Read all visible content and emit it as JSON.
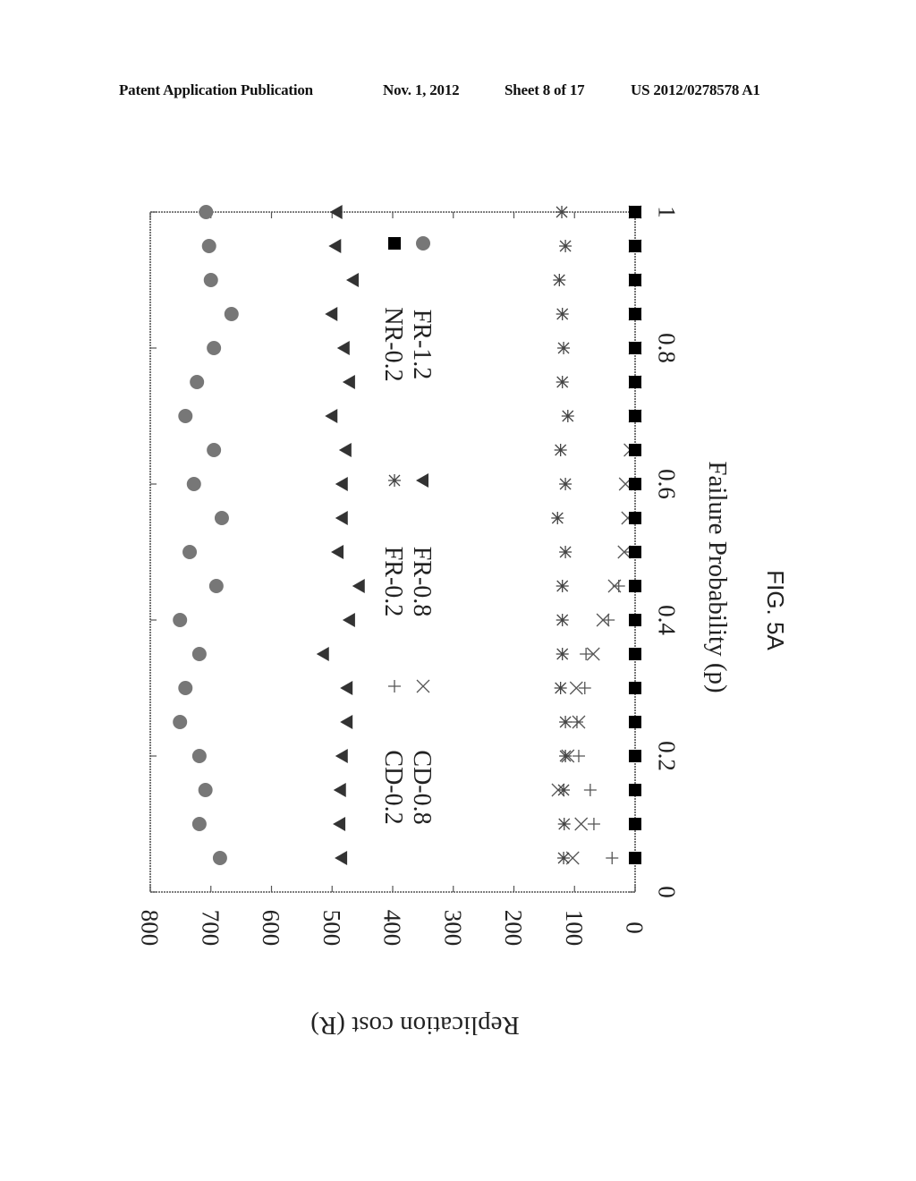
{
  "header": {
    "publication": "Patent Application Publication",
    "date": "Nov. 1, 2012",
    "sheet": "Sheet 8 of 17",
    "number": "US 2012/0278578 A1"
  },
  "figure": {
    "caption": "FIG. 5A",
    "orientation": "rotated 90 degrees clockwise"
  },
  "chart_data": {
    "type": "scatter",
    "title": "",
    "xlabel": "Failure Probability (p)",
    "ylabel": "Replication cost (R)",
    "xlim": [
      0,
      1
    ],
    "ylim": [
      0,
      800
    ],
    "xticks": [
      "0",
      "0.2",
      "0.4",
      "0.6",
      "0.8",
      "1"
    ],
    "xtick_values": [
      0,
      0.2,
      0.4,
      0.6,
      0.8,
      1
    ],
    "yticks": [
      "0",
      "100",
      "200",
      "300",
      "400",
      "500",
      "600",
      "700",
      "800"
    ],
    "ytick_values": [
      0,
      100,
      200,
      300,
      400,
      500,
      600,
      700,
      800
    ],
    "grid": false,
    "legend_placement": "inside, center band",
    "x": [
      0.05,
      0.1,
      0.15,
      0.2,
      0.25,
      0.3,
      0.35,
      0.4,
      0.45,
      0.5,
      0.55,
      0.6,
      0.65,
      0.7,
      0.75,
      0.8,
      0.85,
      0.9,
      0.95,
      1.0
    ],
    "series": [
      {
        "name": "CD-0.2",
        "marker": "plus",
        "color": "#555555",
        "values": [
          38,
          68,
          74,
          93,
          96,
          83,
          81,
          44,
          27,
          7,
          0,
          0,
          0,
          0,
          0,
          0,
          0,
          0,
          0,
          0
        ]
      },
      {
        "name": "CD-0.8",
        "marker": "cross",
        "color": "#555555",
        "values": [
          103,
          89,
          127,
          111,
          93,
          97,
          69,
          53,
          34,
          18,
          12,
          16,
          8,
          0,
          0,
          0,
          0,
          0,
          0,
          0
        ]
      },
      {
        "name": "FR-0.2",
        "marker": "asterisk",
        "color": "#444444",
        "values": [
          118,
          117,
          118,
          115,
          115,
          123,
          120,
          120,
          120,
          115,
          128,
          115,
          123,
          111,
          120,
          118,
          120,
          125,
          115,
          121
        ]
      },
      {
        "name": "FR-0.8",
        "marker": "triangle",
        "color": "#333333",
        "values": [
          484,
          487,
          486,
          483,
          475,
          475,
          514,
          471,
          455,
          490,
          483,
          483,
          477,
          500,
          471,
          480,
          500,
          465,
          494,
          492
        ]
      },
      {
        "name": "NR-0.2",
        "marker": "square",
        "color": "#000000",
        "values": [
          0,
          0,
          0,
          0,
          0,
          0,
          0,
          0,
          0,
          0,
          0,
          0,
          0,
          0,
          0,
          0,
          0,
          0,
          0,
          0
        ]
      },
      {
        "name": "FR-1.2",
        "marker": "circle",
        "color": "#777777",
        "values": [
          685,
          719,
          709,
          719,
          751,
          742,
          719,
          751,
          691,
          735,
          682,
          728,
          695,
          742,
          723,
          695,
          666,
          700,
          703,
          708
        ]
      }
    ]
  }
}
